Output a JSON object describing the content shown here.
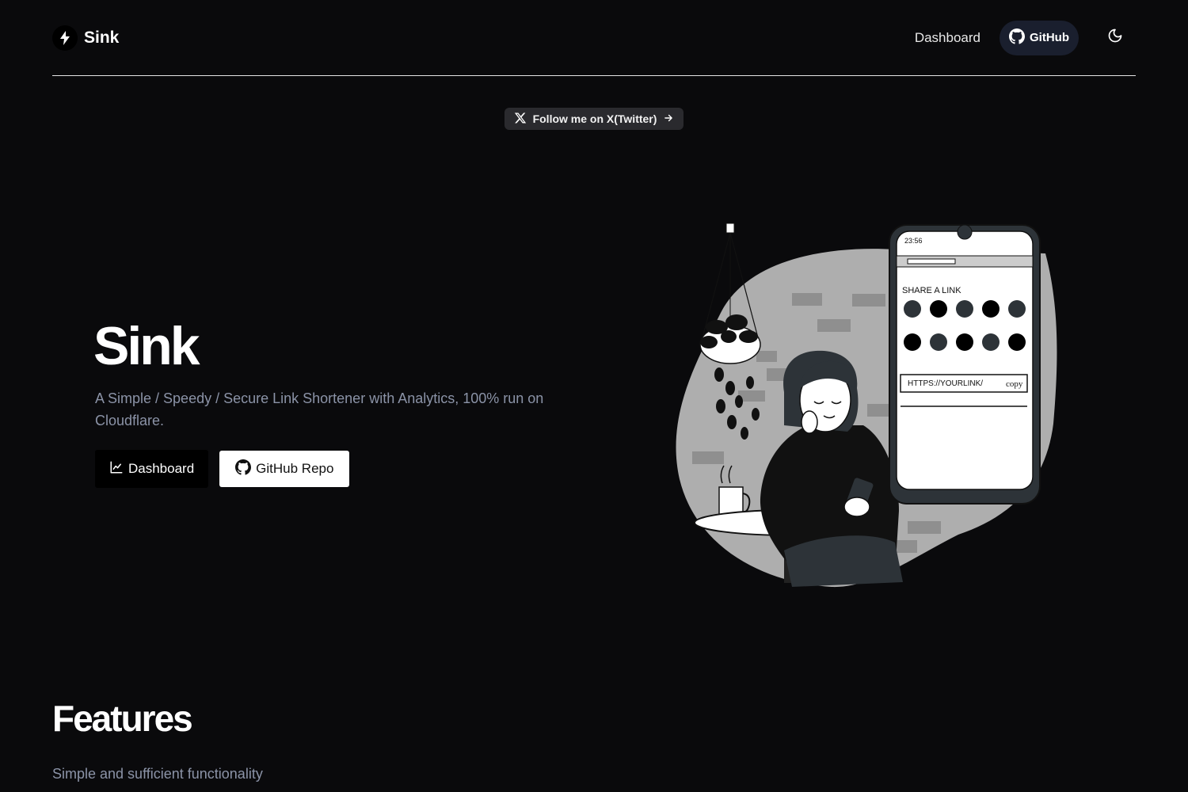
{
  "header": {
    "brand": "Sink",
    "nav": {
      "dashboard": "Dashboard",
      "github": "GitHub"
    }
  },
  "announcement": {
    "label": "Follow me on X(Twitter)"
  },
  "hero": {
    "title": "Sink",
    "subtitle": "A Simple / Speedy / Secure Link Shortener with Analytics, 100% run on Cloudflare.",
    "primary_button": "Dashboard",
    "secondary_button": "GitHub Repo"
  },
  "illustration": {
    "phone_time": "23:56",
    "share_heading": "SHARE A LINK",
    "link_text": "HTTPS://YOURLINK/",
    "copy_label": "copy"
  },
  "features": {
    "title": "Features",
    "subtitle": "Simple and sufficient functionality"
  },
  "colors": {
    "background": "#0a0a0c",
    "muted_text": "#8b93a7",
    "github_pill": "#1a1f2e",
    "pill_bg": "#2a2a2e"
  },
  "icons": [
    "bolt-icon",
    "github-icon",
    "moon-icon",
    "x-logo-icon",
    "arrow-right-icon",
    "chart-icon"
  ]
}
